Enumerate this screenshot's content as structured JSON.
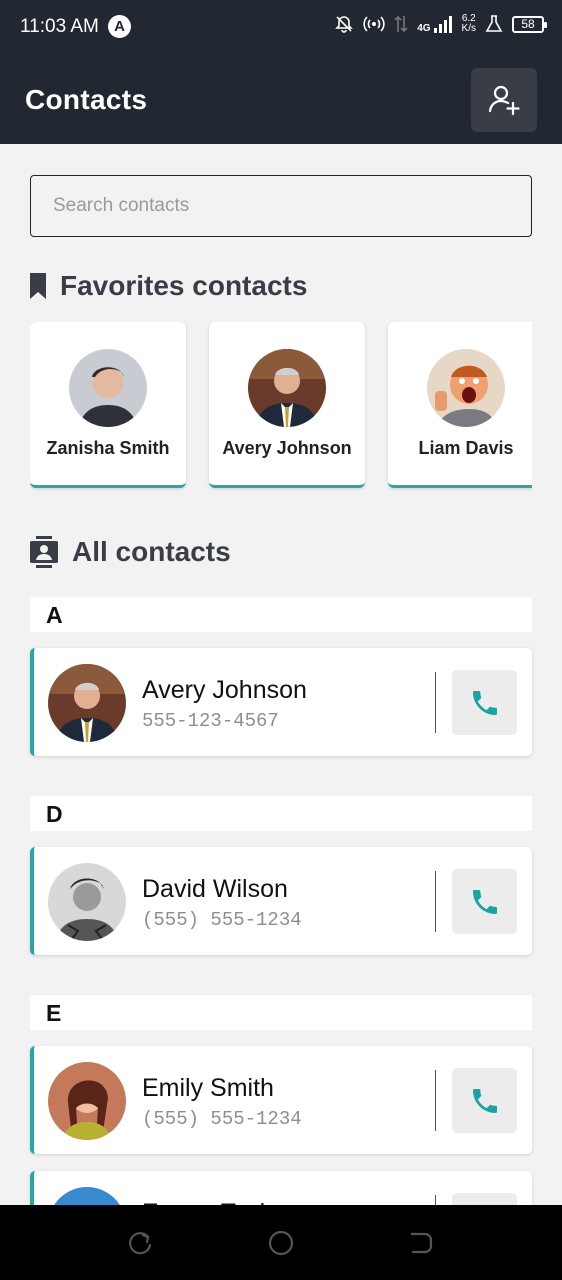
{
  "status_bar": {
    "time": "11:03 AM",
    "app_badge": "A",
    "network_type": "4G",
    "speed_value": "6.2",
    "speed_unit": "K/s",
    "battery": "58"
  },
  "app_bar": {
    "title": "Contacts",
    "add_icon": "add-person-icon"
  },
  "search": {
    "placeholder": "Search contacts",
    "value": ""
  },
  "favorites": {
    "title": "Favorites contacts",
    "icon": "bookmark-icon",
    "items": [
      {
        "name": "Zanisha Smith"
      },
      {
        "name": "Avery Johnson"
      },
      {
        "name": "Liam Davis"
      }
    ]
  },
  "all_contacts": {
    "title": "All contacts",
    "icon": "contacts-book-icon",
    "groups": [
      {
        "letter": "A",
        "contacts": [
          {
            "name": "Avery Johnson",
            "phone": "555-123-4567"
          }
        ]
      },
      {
        "letter": "D",
        "contacts": [
          {
            "name": "David Wilson",
            "phone": "(555) 555-1234"
          }
        ]
      },
      {
        "letter": "E",
        "contacts": [
          {
            "name": "Emily Smith",
            "phone": "(555) 555-1234"
          },
          {
            "name": "Emma Taylor",
            "phone": ""
          }
        ]
      }
    ]
  },
  "colors": {
    "header_bg": "#222831",
    "accent": "#26a6a6",
    "button_bg": "#393e46",
    "page_bg": "#f2f2f2"
  },
  "nav_bar": {
    "icons": [
      "recents-icon",
      "home-icon",
      "back-icon"
    ]
  }
}
